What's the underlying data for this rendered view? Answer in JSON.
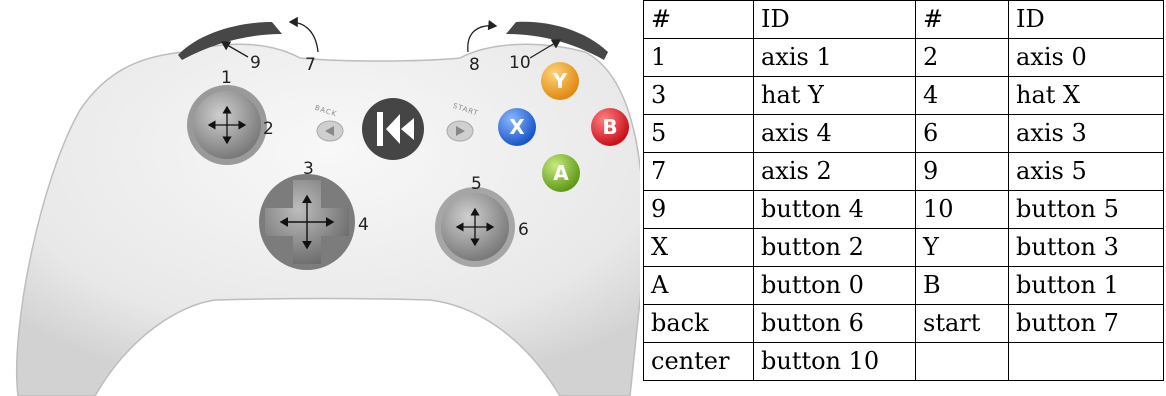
{
  "diagram": {
    "callouts": {
      "n1": "1",
      "n2": "2",
      "n3": "3",
      "n4": "4",
      "n5": "5",
      "n6": "6",
      "n7": "7",
      "n8": "8",
      "n9": "9",
      "n10": "10"
    },
    "face_buttons": {
      "y": "Y",
      "b": "B",
      "x": "X",
      "a": "A"
    },
    "small_labels": {
      "back": "BACK",
      "start": "START"
    },
    "colors": {
      "y": "#f0a020",
      "b": "#e0202a",
      "x": "#2a6fe0",
      "a": "#7fb62a",
      "body": "#eeeeee",
      "trigger": "#4a4a4a",
      "stick": "#8a8a8a",
      "center": "#444444"
    },
    "icons": [
      "kivy-logo-icon",
      "back-arrow-icon",
      "start-arrow-icon",
      "cross-arrows-icon"
    ]
  },
  "table": {
    "rows": [
      [
        "#",
        "ID",
        "#",
        "ID"
      ],
      [
        "1",
        "axis 1",
        "2",
        "axis 0"
      ],
      [
        "3",
        "hat Y",
        "4",
        "hat X"
      ],
      [
        "5",
        "axis 4",
        "6",
        "axis 3"
      ],
      [
        "7",
        "axis 2",
        "9",
        "axis 5"
      ],
      [
        "9",
        "button 4",
        "10",
        "button 5"
      ],
      [
        "X",
        "button 2",
        "Y",
        "button 3"
      ],
      [
        "A",
        "button 0",
        "B",
        "button 1"
      ],
      [
        "back",
        "button 6",
        "start",
        "button 7"
      ],
      [
        "center",
        "button 10",
        "",
        ""
      ]
    ]
  }
}
